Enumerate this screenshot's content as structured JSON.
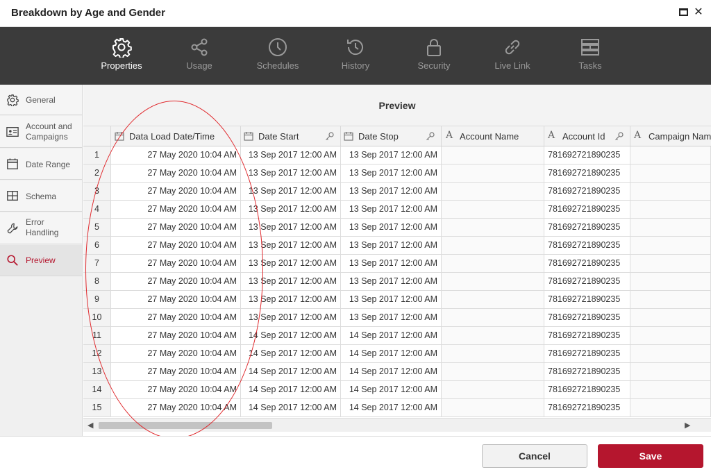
{
  "window": {
    "title": "Breakdown by Age and Gender"
  },
  "toolbar": {
    "items": [
      {
        "label": "Properties",
        "icon": "gear-icon",
        "active": true
      },
      {
        "label": "Usage",
        "icon": "share-icon"
      },
      {
        "label": "Schedules",
        "icon": "clock-icon"
      },
      {
        "label": "History",
        "icon": "history-icon"
      },
      {
        "label": "Security",
        "icon": "lock-icon"
      },
      {
        "label": "Live Link",
        "icon": "link-icon"
      },
      {
        "label": "Tasks",
        "icon": "tasks-icon"
      }
    ]
  },
  "sidebar": {
    "items": [
      {
        "label": "General",
        "icon": "gear-icon"
      },
      {
        "label": "Account and Campaigns",
        "line1": "Account and",
        "line2": "Campaigns",
        "icon": "id-card-icon"
      },
      {
        "label": "Date Range",
        "icon": "calendar-icon"
      },
      {
        "label": "Schema",
        "icon": "grid-icon"
      },
      {
        "label": "Error Handling",
        "line1": "Error",
        "line2": "Handling",
        "icon": "wrench-icon"
      },
      {
        "label": "Preview",
        "icon": "search-icon",
        "active": true
      }
    ]
  },
  "preview": {
    "title": "Preview",
    "columns": [
      {
        "label": "Data Load Date/Time",
        "type": "date",
        "key_icon": false
      },
      {
        "label": "Date Start",
        "type": "date",
        "key_icon": true
      },
      {
        "label": "Date Stop",
        "type": "date",
        "key_icon": true
      },
      {
        "label": "Account Name",
        "type": "text",
        "key_icon": false
      },
      {
        "label": "Account Id",
        "type": "text",
        "key_icon": true
      },
      {
        "label": "Campaign Nam",
        "type": "text",
        "key_icon": false
      }
    ],
    "rows": [
      {
        "n": "1",
        "load": "27 May 2020 10:04 AM",
        "start": "13 Sep 2017 12:00 AM",
        "stop": "13 Sep 2017 12:00 AM",
        "account_id": "781692721890235"
      },
      {
        "n": "2",
        "load": "27 May 2020 10:04 AM",
        "start": "13 Sep 2017 12:00 AM",
        "stop": "13 Sep 2017 12:00 AM",
        "account_id": "781692721890235"
      },
      {
        "n": "3",
        "load": "27 May 2020 10:04 AM",
        "start": "13 Sep 2017 12:00 AM",
        "stop": "13 Sep 2017 12:00 AM",
        "account_id": "781692721890235"
      },
      {
        "n": "4",
        "load": "27 May 2020 10:04 AM",
        "start": "13 Sep 2017 12:00 AM",
        "stop": "13 Sep 2017 12:00 AM",
        "account_id": "781692721890235"
      },
      {
        "n": "5",
        "load": "27 May 2020 10:04 AM",
        "start": "13 Sep 2017 12:00 AM",
        "stop": "13 Sep 2017 12:00 AM",
        "account_id": "781692721890235"
      },
      {
        "n": "6",
        "load": "27 May 2020 10:04 AM",
        "start": "13 Sep 2017 12:00 AM",
        "stop": "13 Sep 2017 12:00 AM",
        "account_id": "781692721890235"
      },
      {
        "n": "7",
        "load": "27 May 2020 10:04 AM",
        "start": "13 Sep 2017 12:00 AM",
        "stop": "13 Sep 2017 12:00 AM",
        "account_id": "781692721890235"
      },
      {
        "n": "8",
        "load": "27 May 2020 10:04 AM",
        "start": "13 Sep 2017 12:00 AM",
        "stop": "13 Sep 2017 12:00 AM",
        "account_id": "781692721890235"
      },
      {
        "n": "9",
        "load": "27 May 2020 10:04 AM",
        "start": "13 Sep 2017 12:00 AM",
        "stop": "13 Sep 2017 12:00 AM",
        "account_id": "781692721890235"
      },
      {
        "n": "10",
        "load": "27 May 2020 10:04 AM",
        "start": "13 Sep 2017 12:00 AM",
        "stop": "13 Sep 2017 12:00 AM",
        "account_id": "781692721890235"
      },
      {
        "n": "11",
        "load": "27 May 2020 10:04 AM",
        "start": "14 Sep 2017 12:00 AM",
        "stop": "14 Sep 2017 12:00 AM",
        "account_id": "781692721890235"
      },
      {
        "n": "12",
        "load": "27 May 2020 10:04 AM",
        "start": "14 Sep 2017 12:00 AM",
        "stop": "14 Sep 2017 12:00 AM",
        "account_id": "781692721890235"
      },
      {
        "n": "13",
        "load": "27 May 2020 10:04 AM",
        "start": "14 Sep 2017 12:00 AM",
        "stop": "14 Sep 2017 12:00 AM",
        "account_id": "781692721890235"
      },
      {
        "n": "14",
        "load": "27 May 2020 10:04 AM",
        "start": "14 Sep 2017 12:00 AM",
        "stop": "14 Sep 2017 12:00 AM",
        "account_id": "781692721890235"
      },
      {
        "n": "15",
        "load": "27 May 2020 10:04 AM",
        "start": "14 Sep 2017 12:00 AM",
        "stop": "14 Sep 2017 12:00 AM",
        "account_id": "781692721890235"
      }
    ]
  },
  "footer": {
    "cancel_label": "Cancel",
    "save_label": "Save"
  },
  "colors": {
    "accent": "#b5162e",
    "toolbar_bg": "#3b3b3b",
    "annotation": "#e0282c"
  }
}
